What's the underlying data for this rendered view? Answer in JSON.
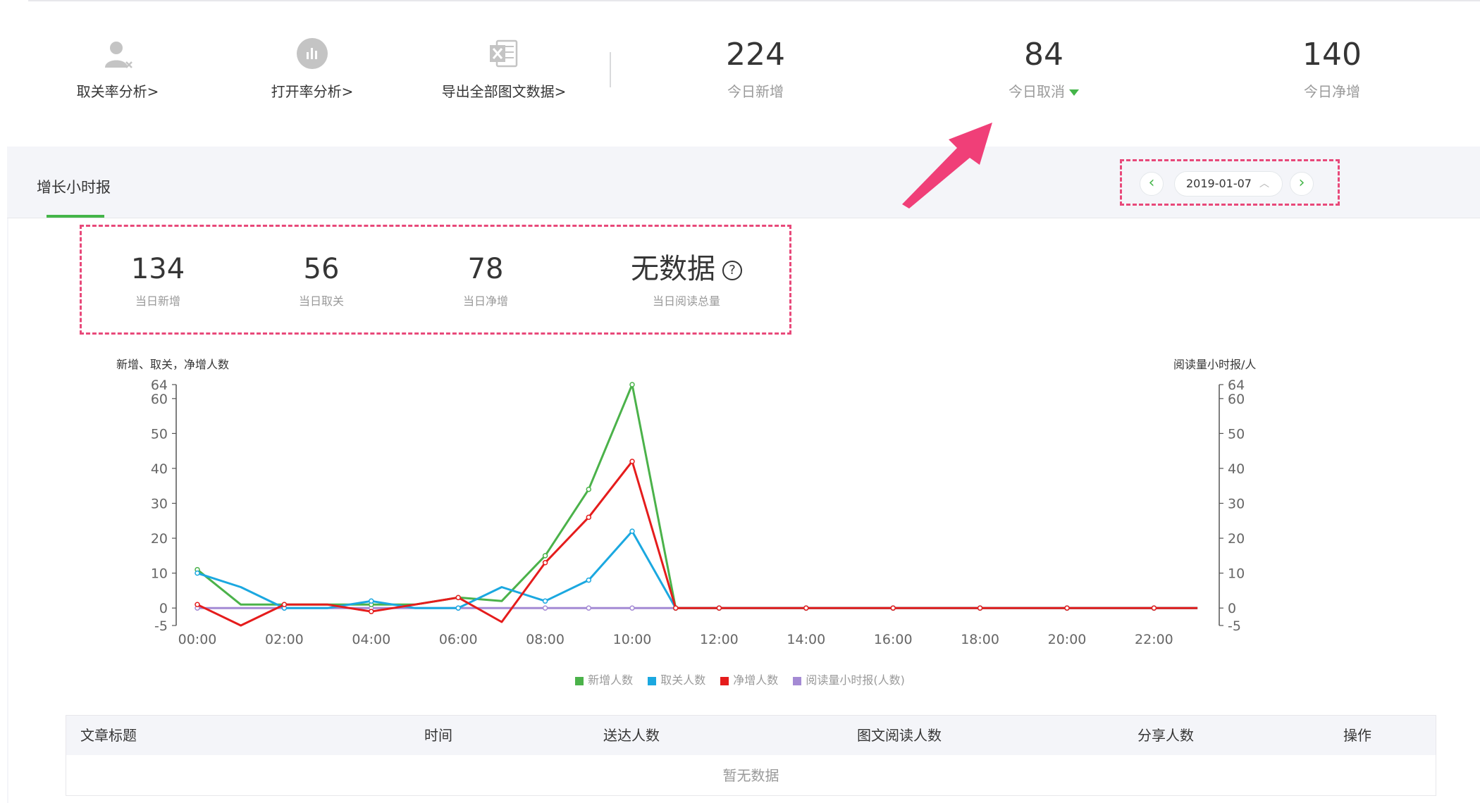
{
  "toolbar": [
    {
      "label": "取关率分析>"
    },
    {
      "label": "打开率分析>"
    },
    {
      "label": "导出全部图文数据>"
    }
  ],
  "summary": {
    "new": {
      "value": "224",
      "label": "今日新增"
    },
    "cancel": {
      "value": "84",
      "label": "今日取消"
    },
    "net": {
      "value": "140",
      "label": "今日净增"
    }
  },
  "panel": {
    "title": "增长小时报",
    "date": "2019-01-07"
  },
  "day_stats": [
    {
      "value": "134",
      "label": "当日新增"
    },
    {
      "value": "56",
      "label": "当日取关"
    },
    {
      "value": "78",
      "label": "当日净增"
    },
    {
      "value": "无数据",
      "label": "当日阅读总量"
    }
  ],
  "colors": {
    "accent": "#44b549",
    "annotation": "#e8497a",
    "new": "#4bb24a",
    "cancel": "#1ba8e0",
    "net": "#e51c1c",
    "read": "#a48ad4"
  },
  "chart_data": {
    "type": "line",
    "ylabel_left": "新增、取关，净增人数",
    "ylabel_right": "阅读量小时报/人",
    "y_ticks": [
      -5,
      0,
      10,
      20,
      30,
      40,
      50,
      60,
      64
    ],
    "ylim": [
      -5,
      64
    ],
    "x_ticks": [
      "00:00",
      "02:00",
      "04:00",
      "06:00",
      "08:00",
      "10:00",
      "12:00",
      "14:00",
      "16:00",
      "18:00",
      "20:00",
      "22:00"
    ],
    "x_hours": [
      0,
      1,
      2,
      3,
      4,
      5,
      6,
      7,
      8,
      9,
      10,
      11,
      12,
      13,
      14,
      15,
      16,
      17,
      18,
      19,
      20,
      21,
      22,
      23
    ],
    "series": [
      {
        "name": "新增人数",
        "values": [
          11,
          1,
          1,
          1,
          1,
          1,
          3,
          2,
          15,
          34,
          64,
          0,
          0,
          0,
          0,
          0,
          0,
          0,
          0,
          0,
          0,
          0,
          0,
          0
        ]
      },
      {
        "name": "取关人数",
        "values": [
          10,
          6,
          0,
          0,
          2,
          0,
          0,
          6,
          2,
          8,
          22,
          0,
          0,
          0,
          0,
          0,
          0,
          0,
          0,
          0,
          0,
          0,
          0,
          0
        ]
      },
      {
        "name": "净增人数",
        "values": [
          1,
          -5,
          1,
          1,
          -1,
          1,
          3,
          -4,
          13,
          26,
          42,
          0,
          0,
          0,
          0,
          0,
          0,
          0,
          0,
          0,
          0,
          0,
          0,
          0
        ]
      },
      {
        "name": "阅读量小时报(人数)",
        "values": [
          0,
          0,
          0,
          0,
          0,
          0,
          0,
          0,
          0,
          0,
          0,
          0,
          0,
          0,
          0,
          0,
          0,
          0,
          0,
          0,
          0,
          0,
          0,
          0
        ]
      }
    ],
    "legend_position": "bottom-center",
    "grid": false
  },
  "table": {
    "columns": [
      "文章标题",
      "时间",
      "送达人数",
      "图文阅读人数",
      "分享人数",
      "操作"
    ],
    "empty_text": "暂无数据"
  }
}
